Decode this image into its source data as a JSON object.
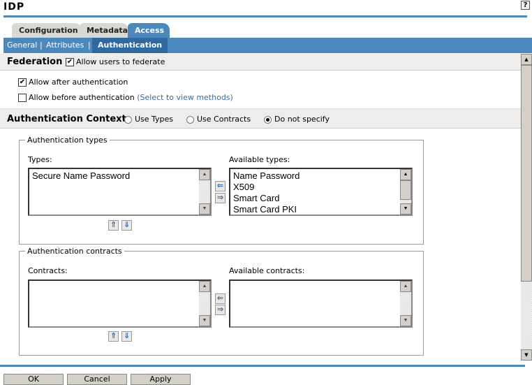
{
  "title": "IDP",
  "help": "?",
  "tabs": [
    "Configuration",
    "Metadata",
    "Access"
  ],
  "subnav": [
    "General",
    "Attributes",
    "Authentication"
  ],
  "federation": {
    "heading": "Federation",
    "allow_federate": "Allow users to federate",
    "allow_after": "Allow after authentication",
    "allow_before": "Allow before authentication",
    "select_link": "(Select to view methods)"
  },
  "auth_context": {
    "heading": "Authentication Context",
    "options": [
      "Use Types",
      "Use Contracts",
      "Do not specify"
    ],
    "selected": "Do not specify"
  },
  "types_box": {
    "legend": "Authentication types",
    "types_label": "Types:",
    "types": [
      "Secure Name Password"
    ],
    "available_label": "Available types:",
    "available": [
      "Name Password",
      "X509",
      "Smart Card",
      "Smart Card PKI"
    ]
  },
  "contracts_box": {
    "legend": "Authentication contracts",
    "contracts_label": "Contracts:",
    "available_label": "Available contracts:"
  },
  "buttons": {
    "ok": "OK",
    "cancel": "Cancel",
    "apply": "Apply"
  }
}
